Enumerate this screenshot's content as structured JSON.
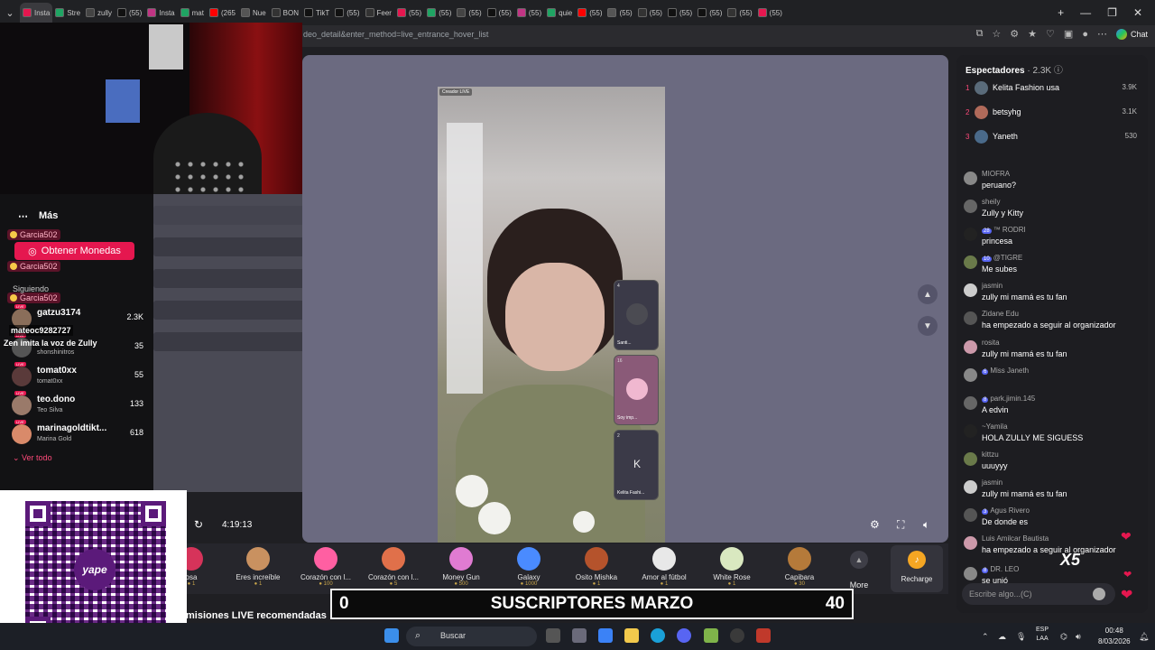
{
  "browser": {
    "tabs": [
      "Insta",
      "Stre",
      "zully",
      "(55)",
      "Insta",
      "mat",
      "(265",
      "Nue",
      "BON",
      "TikT",
      "(55)",
      "Feer",
      "(55)",
      "(55)",
      "(55)",
      "(55)",
      "(55)",
      "quie",
      "(55)",
      "(55)",
      "(55)",
      "(55)",
      "(55)",
      "(55)",
      "(55)"
    ],
    "url": "deo_detail&enter_method=live_entrance_hover_list",
    "chat_label": "Chat"
  },
  "left_sidebar": {
    "more_label": "Más",
    "coins_button": "Obtener Monedas",
    "gift_alert_user": "Garcia502",
    "following_label": "Siguiendo",
    "overlay_user": "mateoc9282727",
    "overlay_message": "Zen imita la voz de Zully",
    "following": [
      {
        "name": "gatzu3174",
        "sub": "",
        "viewers": "2.3K"
      },
      {
        "name": "",
        "sub": "shonshinitros",
        "viewers": "35"
      },
      {
        "name": "tomat0xx",
        "sub": "tomat0xx",
        "viewers": "55"
      },
      {
        "name": "teo.dono",
        "sub": "Teo Silva",
        "viewers": "133"
      },
      {
        "name": "marinagoldtikt...",
        "sub": "Marina Gold",
        "viewers": "618"
      }
    ],
    "see_all": "Ver todo"
  },
  "player": {
    "live_tag": "Creador LIVE",
    "timer": "4:19:13",
    "guests": [
      {
        "badge": "4",
        "name": "Santi..."
      },
      {
        "badge": "16",
        "name": "Soy imp..."
      },
      {
        "badge": "2",
        "name": "Kelita Fashi...",
        "initial": "K"
      }
    ]
  },
  "gifts": [
    {
      "name": "osa",
      "price": "1",
      "color": "#d6335a"
    },
    {
      "name": "Eres increíble",
      "price": "1",
      "color": "#c99160"
    },
    {
      "name": "Corazón con l...",
      "price": "100",
      "color": "#ff5fa2"
    },
    {
      "name": "Corazón con l...",
      "price": "5",
      "color": "#e0704a"
    },
    {
      "name": "Money Gun",
      "price": "500",
      "color": "#e07bd2"
    },
    {
      "name": "Galaxy",
      "price": "1000",
      "color": "#4a8bff"
    },
    {
      "name": "Osito Mishka",
      "price": "1",
      "color": "#b5532c"
    },
    {
      "name": "Amor al fútbol",
      "price": "1",
      "color": "#e8e8e8"
    },
    {
      "name": "White Rose",
      "price": "1",
      "color": "#d9e8c0"
    },
    {
      "name": "Capibara",
      "price": "30",
      "color": "#b57a3a"
    }
  ],
  "gift_more": "More",
  "recharge": "Recharge",
  "subs_bar": {
    "left": "0",
    "title": "SUSCRIPTORES MARZO",
    "right": "40"
  },
  "recommend_label": "misiones LIVE recomendadas",
  "right_panel": {
    "spectators_label": "Espectadores",
    "spectators_count": "· 2.3K",
    "top_viewers": [
      {
        "rank": "1",
        "name": "Kelita Fashion usa",
        "score": "3.9K"
      },
      {
        "rank": "2",
        "name": "betsyhg",
        "score": "3.1K"
      },
      {
        "rank": "3",
        "name": "Yaneth",
        "score": "530"
      }
    ],
    "chat": [
      {
        "user": "MIOFRA",
        "msg": "peruano?",
        "lvl": ""
      },
      {
        "user": "sheily",
        "msg": "Zully y Kitty",
        "lvl": ""
      },
      {
        "user": "™ RODRI",
        "msg": "princesa",
        "lvl": "28"
      },
      {
        "user": "@TIGRE",
        "msg": "Me subes",
        "lvl": "10"
      },
      {
        "user": "jasmin",
        "msg": "zully mi mamá es tu fan",
        "lvl": ""
      },
      {
        "user": "Zidane Edu",
        "msg": "ha empezado a seguir al organizador",
        "lvl": ""
      },
      {
        "user": "rosita",
        "msg": "zully mi mamá es tu fan",
        "lvl": ""
      },
      {
        "user": "Miss Janeth",
        "msg": "",
        "lvl": "6"
      },
      {
        "user": "park.jimin.145",
        "msg": "A edvin",
        "lvl": "8"
      },
      {
        "user": "~Yamila",
        "msg": "HOLA ZULLY ME SIGUESS",
        "lvl": ""
      },
      {
        "user": "kittzu",
        "msg": "uuuyyy",
        "lvl": ""
      },
      {
        "user": "jasmin",
        "msg": "zully mi mamá es tu fan",
        "lvl": ""
      },
      {
        "user": "Agus Rivero",
        "msg": "De donde es",
        "lvl": "3"
      },
      {
        "user": "Luis Amilcar Bautista",
        "msg": "ha empezado a seguir al organizador",
        "lvl": ""
      },
      {
        "user": "DR. LEO",
        "msg": "se unió",
        "lvl": "8"
      }
    ],
    "combo": "X5",
    "input_placeholder": "Escribe algo...(C)"
  },
  "taskbar": {
    "search_label": "Buscar",
    "lang": "ESP",
    "region": "LAA",
    "time": "00:48",
    "date": "8/03/2026"
  }
}
